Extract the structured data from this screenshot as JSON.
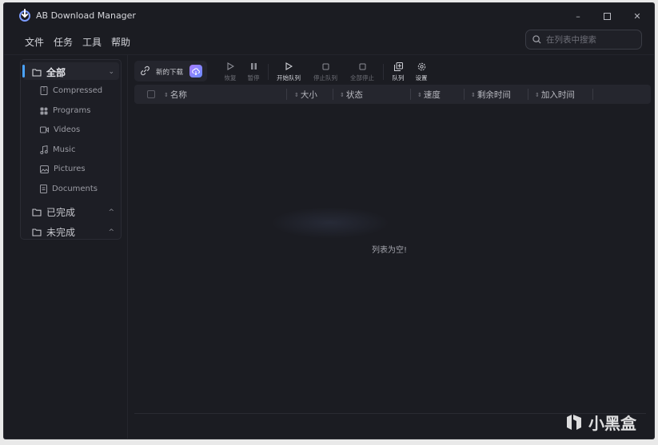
{
  "window": {
    "title": "AB Download Manager"
  },
  "menu": [
    "文件",
    "任务",
    "工具",
    "帮助"
  ],
  "search": {
    "placeholder": "在列表中搜索"
  },
  "sidebar": {
    "all": {
      "label": "全部",
      "items": [
        "Compressed",
        "Programs",
        "Videos",
        "Music",
        "Pictures",
        "Documents"
      ]
    },
    "finished": {
      "label": "已完成"
    },
    "unfinished": {
      "label": "未完成"
    }
  },
  "toolbar": {
    "new_download": "新的下载",
    "resume": "恢复",
    "pause": "暂停",
    "start_queue": "开始队列",
    "stop_queue": "停止队列",
    "stop_all": "全部停止",
    "queues": "队列",
    "settings": "设置"
  },
  "table": {
    "columns": [
      "名称",
      "大小",
      "状态",
      "速度",
      "剩余时间",
      "加入时间"
    ]
  },
  "empty_message": "列表为空!",
  "watermark": "小黑盒",
  "colors": {
    "accent": "#4aa3ff",
    "background": "#1b1c22",
    "badge": "#8f84ff"
  }
}
